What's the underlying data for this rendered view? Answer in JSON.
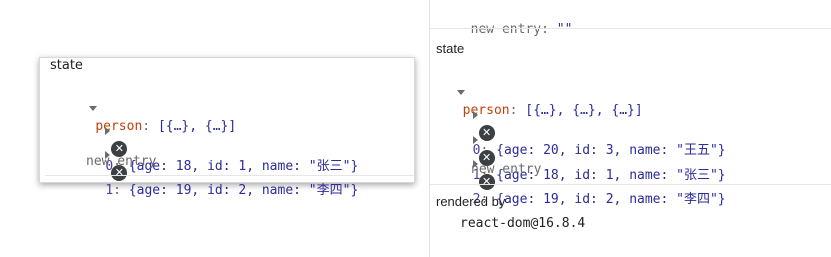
{
  "left_popup": {
    "header": "state",
    "prop_key": "person",
    "prop_summary": "[{…}, {…}]",
    "items": [
      {
        "index": "0",
        "value": "{age: 18, id: 1, name: \"张三\"}"
      },
      {
        "index": "1",
        "value": "{age: 19, id: 2, name: \"李四\"}"
      }
    ],
    "new_entry": "new entry"
  },
  "right_panel": {
    "top_entry_label": "new entry:",
    "top_entry_value": "\"\"",
    "state_header": "state",
    "prop_key": "person",
    "prop_summary": "[{…}, {…}, {…}]",
    "items": [
      {
        "index": "0",
        "value": "{age: 20, id: 3, name: \"王五\"}"
      },
      {
        "index": "1",
        "value": "{age: 18, id: 1, name: \"张三\"}"
      },
      {
        "index": "2",
        "value": "{age: 19, id: 2, name: \"李四\"}"
      }
    ],
    "new_entry": "new entry",
    "rendered_by_header": "rendered by",
    "renderer": "react-dom@16.8.4"
  },
  "colors": {
    "key": "#c2410c",
    "value": "#2b2b9a",
    "badge": "#3c4043"
  }
}
